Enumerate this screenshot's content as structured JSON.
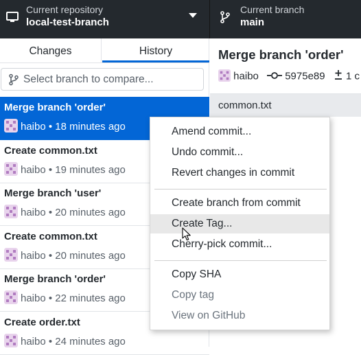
{
  "toolbar": {
    "repo_label": "Current repository",
    "repo_value": "local-test-branch",
    "branch_label": "Current branch",
    "branch_value": "main"
  },
  "tabs": {
    "changes": "Changes",
    "history": "History",
    "active": "History"
  },
  "filter": {
    "placeholder": "Select branch to compare..."
  },
  "commits": [
    {
      "title": "Merge branch 'order'",
      "author": "haibo",
      "time": "18 minutes ago",
      "selected": true
    },
    {
      "title": "Create common.txt",
      "author": "haibo",
      "time": "19 minutes ago"
    },
    {
      "title": "Merge branch 'user'",
      "author": "haibo",
      "time": "20 minutes ago"
    },
    {
      "title": "Create common.txt",
      "author": "haibo",
      "time": "20 minutes ago"
    },
    {
      "title": "Merge branch 'order'",
      "author": "haibo",
      "time": "22 minutes ago"
    },
    {
      "title": "Create order.txt",
      "author": "haibo",
      "time": "24 minutes ago"
    }
  ],
  "detail": {
    "title": "Merge branch 'order'",
    "author": "haibo",
    "sha": "5975e89",
    "files_changed": "1 c",
    "file": "common.txt"
  },
  "context_menu": {
    "groups": [
      [
        "Amend commit...",
        "Undo commit...",
        "Revert changes in commit"
      ],
      [
        "Create branch from commit",
        "Create Tag...",
        "Cherry-pick commit..."
      ],
      [
        "Copy SHA",
        "Copy tag",
        "View on GitHub"
      ]
    ],
    "hovered": "Create Tag...",
    "disabled": [
      "Copy tag",
      "View on GitHub"
    ]
  },
  "colors": {
    "toolbar_bg": "#24292e",
    "selected_bg": "#0366d6",
    "accent": "#0366d6"
  },
  "icons": [
    "desktop-icon",
    "git-branch-icon",
    "chevron-down-icon",
    "git-compare-icon",
    "avatar-icon",
    "git-commit-icon",
    "file-diff-icon",
    "mouse-pointer-icon"
  ]
}
